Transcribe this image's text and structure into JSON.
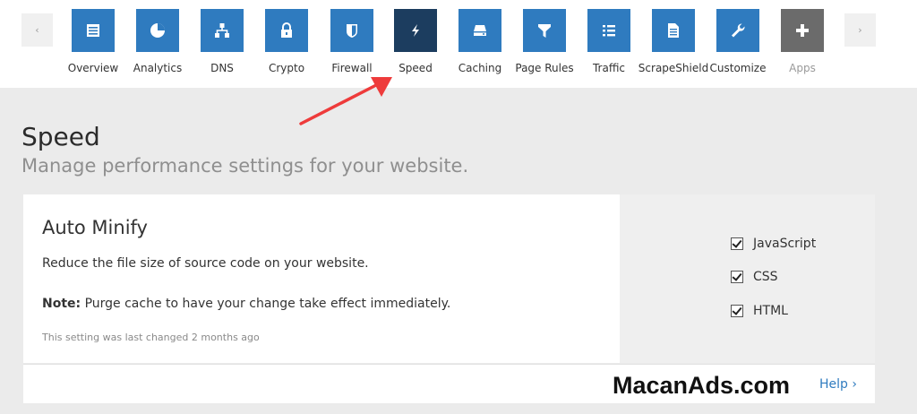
{
  "nav": {
    "prev_arrow": "‹",
    "next_arrow": "›",
    "items": [
      {
        "label": "Overview",
        "icon": "overview-icon"
      },
      {
        "label": "Analytics",
        "icon": "pie-chart-icon"
      },
      {
        "label": "DNS",
        "icon": "network-icon"
      },
      {
        "label": "Crypto",
        "icon": "lock-icon"
      },
      {
        "label": "Firewall",
        "icon": "shield-icon"
      },
      {
        "label": "Speed",
        "icon": "lightning-icon",
        "active": true
      },
      {
        "label": "Caching",
        "icon": "drive-icon"
      },
      {
        "label": "Page Rules",
        "icon": "filter-icon"
      },
      {
        "label": "Traffic",
        "icon": "list-icon"
      },
      {
        "label": "ScrapeShield",
        "icon": "document-icon"
      },
      {
        "label": "Customize",
        "icon": "wrench-icon"
      },
      {
        "label": "Apps",
        "icon": "plus-icon"
      }
    ]
  },
  "page": {
    "title": "Speed",
    "subtitle": "Manage performance settings for your website."
  },
  "card": {
    "title": "Auto Minify",
    "description": "Reduce the file size of source code on your website.",
    "note_label": "Note:",
    "note_text": " Purge cache to have your change take effect immediately.",
    "last_changed": "This setting was last changed 2 months ago",
    "options": [
      {
        "label": "JavaScript",
        "checked": true
      },
      {
        "label": "CSS",
        "checked": true
      },
      {
        "label": "HTML",
        "checked": true
      }
    ],
    "help_label": "Help ›"
  },
  "watermark": "MacanAds.com",
  "colors": {
    "tile": "#2f7bbf",
    "tile_active": "#1c3d5f",
    "tile_apps": "#6b6b6b",
    "annotation_arrow": "#ee3b3b",
    "link": "#2f7bbf"
  }
}
